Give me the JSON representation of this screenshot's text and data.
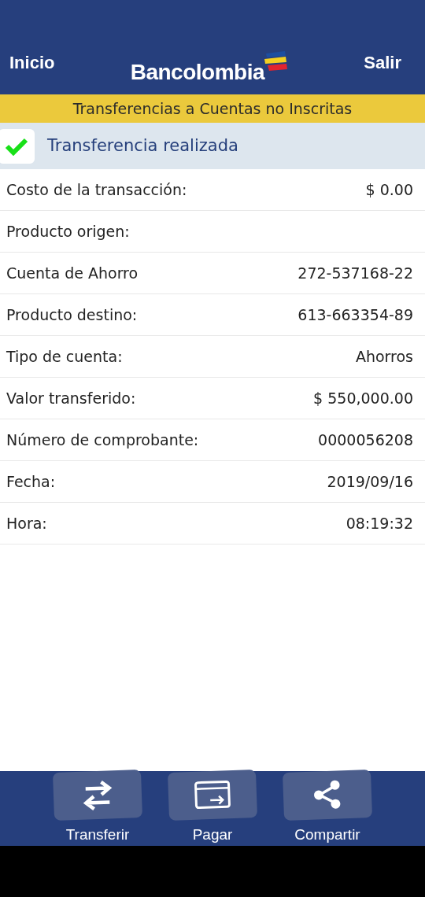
{
  "header": {
    "left_link": "Inicio",
    "logo": "Bancolombia",
    "right_link": "Salir"
  },
  "section_title": "Transferencias a Cuentas no Inscritas",
  "status": {
    "text": "Transferencia realizada",
    "success": true
  },
  "rows": [
    {
      "label": "Costo de la transacción:",
      "value": "$ 0.00"
    },
    {
      "label": "Producto origen:"
    },
    {
      "label": "Cuenta de Ahorro",
      "value": "272-537168-22"
    },
    {
      "label": "Producto destino:",
      "value": "613-663354-89"
    },
    {
      "label": "Tipo de cuenta:",
      "value": "Ahorros"
    },
    {
      "label": "Valor transferido:",
      "value": "$ 550,000.00"
    },
    {
      "label": "Número de comprobante:",
      "value": "0000056208"
    },
    {
      "label": "Fecha:",
      "value": "2019/09/16"
    },
    {
      "label": "Hora:",
      "value": "08:19:32"
    }
  ],
  "actions": [
    {
      "label": "Transferir",
      "kind": "transfer"
    },
    {
      "label": "Pagar",
      "kind": "pay"
    },
    {
      "label": "Compartir",
      "kind": "share"
    }
  ]
}
